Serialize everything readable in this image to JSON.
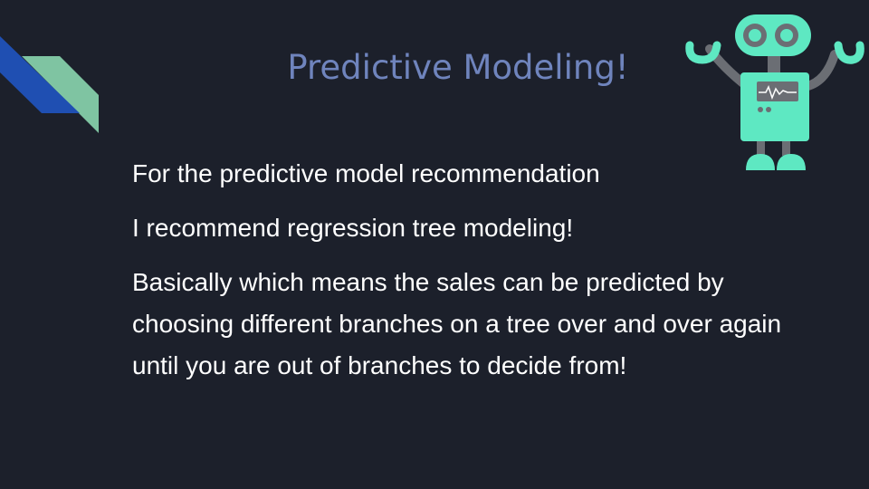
{
  "slide": {
    "title": "Predictive Modeling!",
    "paragraphs": [
      "For the predictive model recommendation",
      "I recommend regression tree modeling!",
      "Basically which means the sales can be predicted by choosing different branches on a tree over and over again until you are out of branches to decide from!"
    ]
  },
  "colors": {
    "background": "#1c202b",
    "title": "#6f84bd",
    "text": "#ffffff",
    "stripe_blue": "#1f4fb2",
    "stripe_green": "#7fc4a2",
    "robot_body": "#5ee8c2",
    "robot_arms": "#6b6e74"
  },
  "icons": {
    "decoration": "diagonal-stripes",
    "illustration": "robot-icon"
  }
}
